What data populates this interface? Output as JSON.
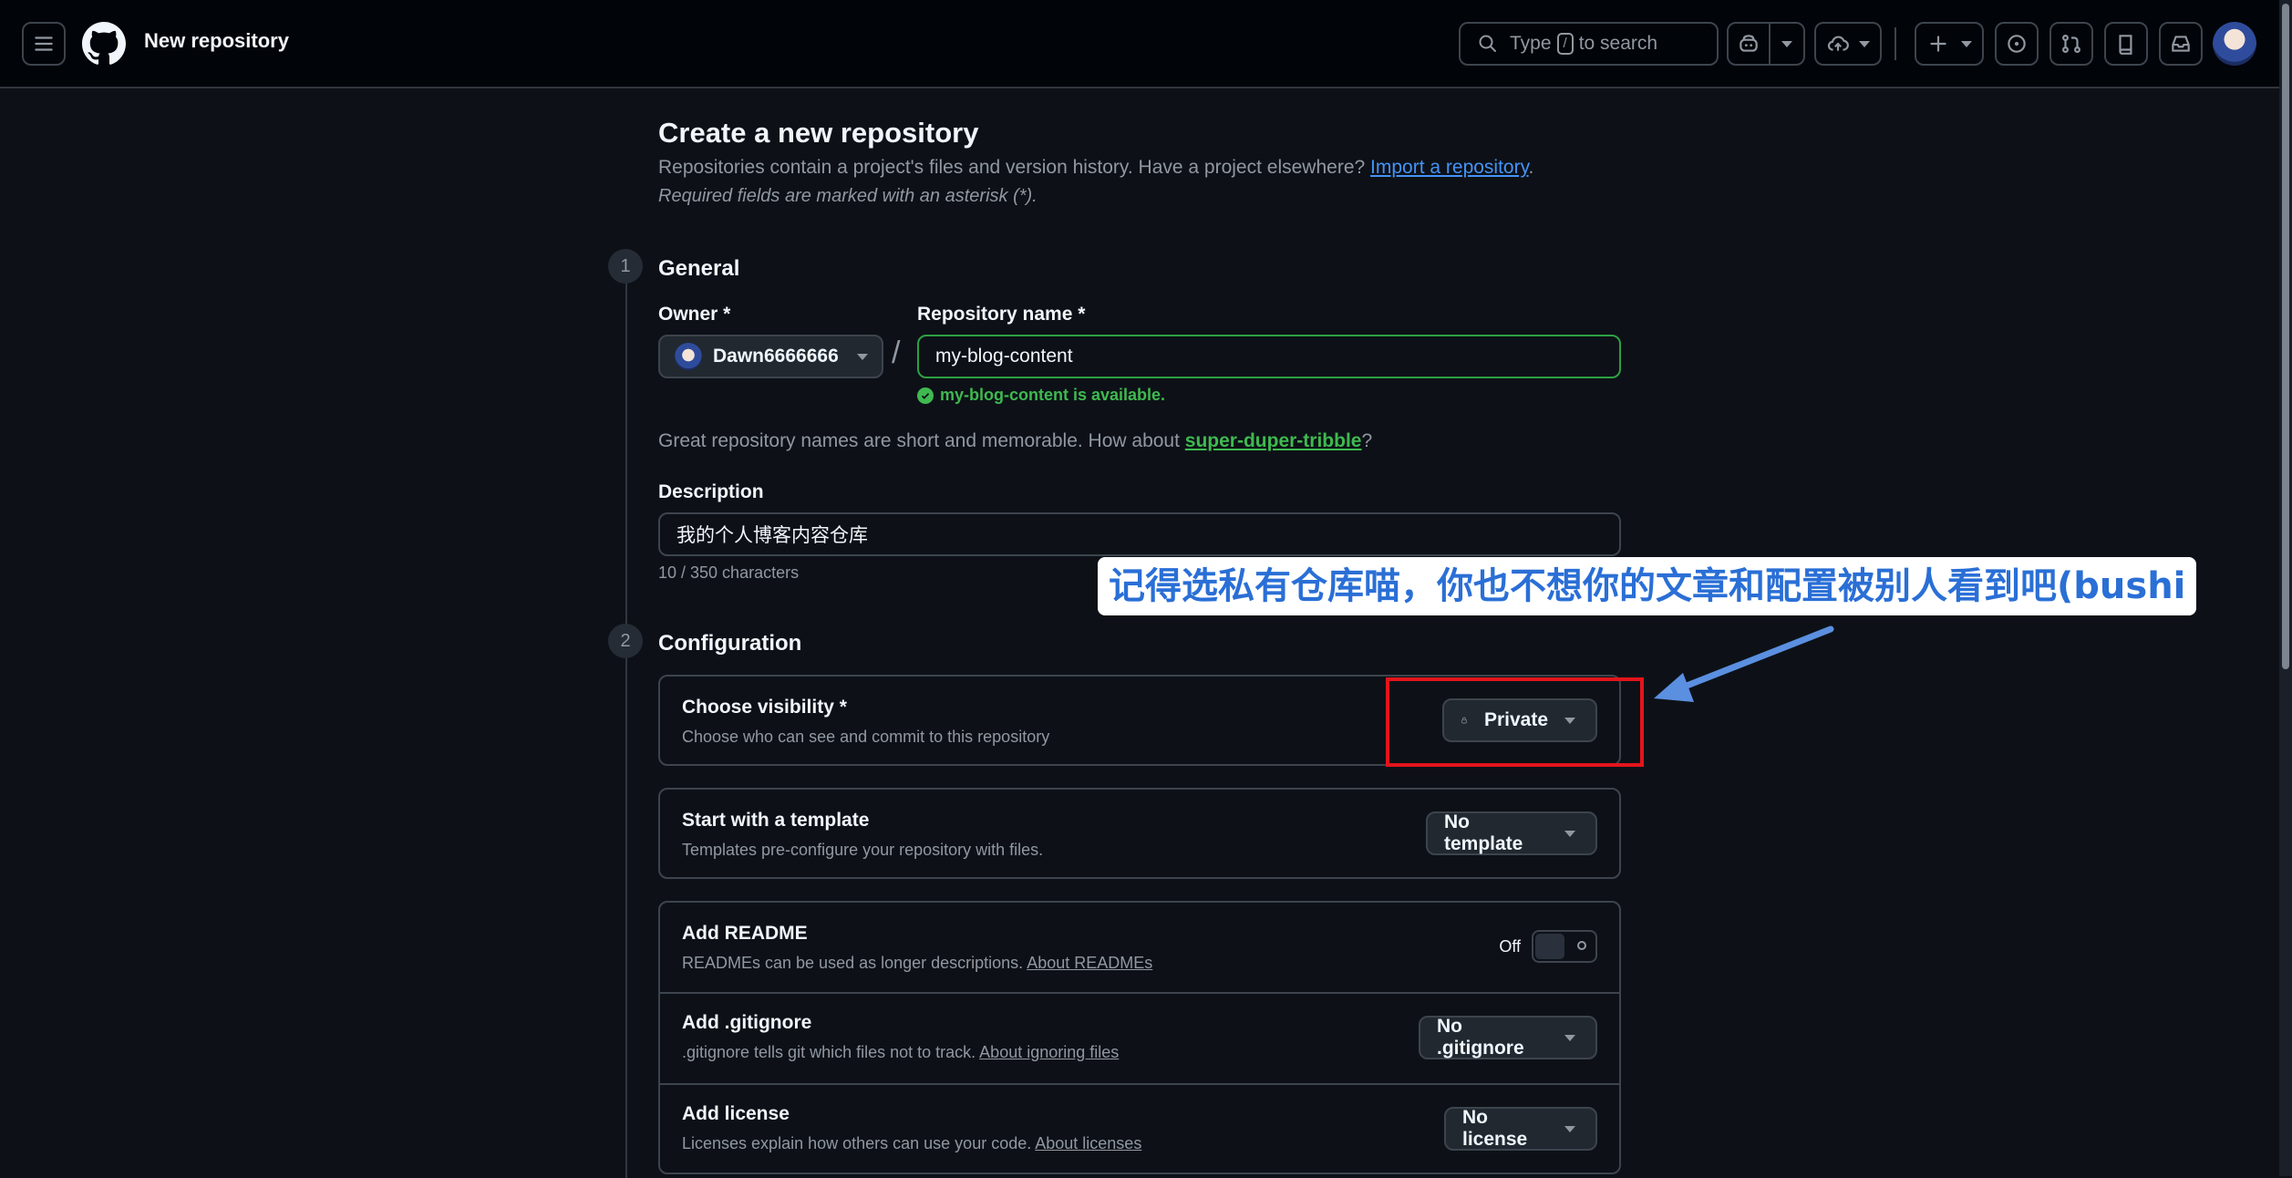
{
  "header": {
    "title": "New repository",
    "search": {
      "prefix": "Type",
      "key": "/",
      "suffix": "to search"
    }
  },
  "page": {
    "title": "Create a new repository",
    "intro": "Repositories contain a project's files and version history. Have a project elsewhere?",
    "import_link": "Import a repository",
    "intro_end": ".",
    "required_note": "Required fields are marked with an asterisk (*)."
  },
  "general": {
    "step": "1",
    "title": "General",
    "owner_label": "Owner *",
    "owner_value": "Dawn6666666",
    "repo_label": "Repository name *",
    "repo_value": "my-blog-content",
    "availability": "my-blog-content is available.",
    "suggest_text": "Great repository names are short and memorable. How about",
    "suggest_link": "super-duper-tribble",
    "suggest_end": "?",
    "description_label": "Description",
    "description_value": "我的个人博客内容仓库",
    "char_count": "10 / 350 characters"
  },
  "configuration": {
    "step": "2",
    "title": "Configuration",
    "visibility": {
      "title": "Choose visibility *",
      "desc": "Choose who can see and commit to this repository",
      "value": "Private"
    },
    "template": {
      "title": "Start with a template",
      "desc": "Templates pre-configure your repository with files.",
      "value": "No template"
    },
    "readme": {
      "title": "Add README",
      "desc": "READMEs can be used as longer descriptions.",
      "link": "About READMEs",
      "toggle_label": "Off"
    },
    "gitignore": {
      "title": "Add .gitignore",
      "desc": ".gitignore tells git which files not to track.",
      "link": "About ignoring files",
      "value": "No .gitignore"
    },
    "license": {
      "title": "Add license",
      "desc": "Licenses explain how others can use your code.",
      "link": "About licenses",
      "value": "No license"
    }
  },
  "annotation": {
    "text": "记得选私有仓库喵，你也不想你的文章和配置被别人看到吧(bushi",
    "color": "#2a6fd6",
    "box_color": "#e4141b"
  }
}
